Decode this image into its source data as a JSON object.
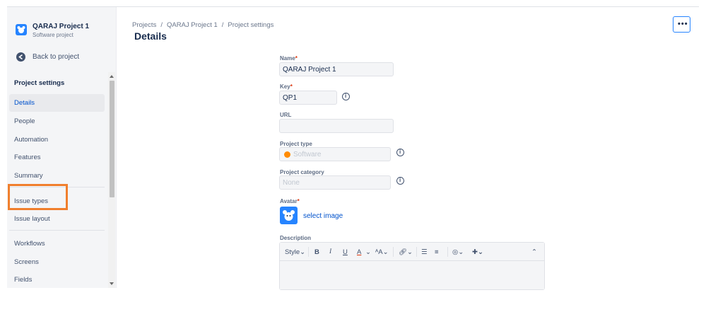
{
  "project": {
    "name": "QARAJ Project 1",
    "type_label": "Software project"
  },
  "sidebar": {
    "back_label": "Back to project",
    "section_title": "Project settings",
    "items": [
      {
        "label": "Details",
        "active": true
      },
      {
        "label": "People"
      },
      {
        "label": "Automation"
      },
      {
        "label": "Features"
      },
      {
        "label": "Summary"
      },
      {
        "label": "Issue types"
      },
      {
        "label": "Issue layout"
      },
      {
        "label": "Workflows"
      },
      {
        "label": "Screens"
      },
      {
        "label": "Fields"
      }
    ]
  },
  "breadcrumb": [
    "Projects",
    "QARAJ Project 1",
    "Project settings"
  ],
  "page_title": "Details",
  "form": {
    "name": {
      "label": "Name",
      "value": "QARAJ Project 1"
    },
    "key": {
      "label": "Key",
      "value": "QP1"
    },
    "url": {
      "label": "URL",
      "value": ""
    },
    "project_type": {
      "label": "Project type",
      "value": "Software"
    },
    "project_category": {
      "label": "Project category",
      "placeholder": "None"
    },
    "avatar": {
      "label": "Avatar",
      "action": "select image"
    },
    "description": {
      "label": "Description",
      "toolbar": {
        "style": "Style",
        "bold": "B",
        "italic": "I",
        "underline": "U",
        "text_color": "A",
        "more_formatting": "ᴬA"
      }
    }
  },
  "colors": {
    "accent": "#0052CC",
    "highlight": "#F07F2D",
    "required": "#DE350B"
  }
}
